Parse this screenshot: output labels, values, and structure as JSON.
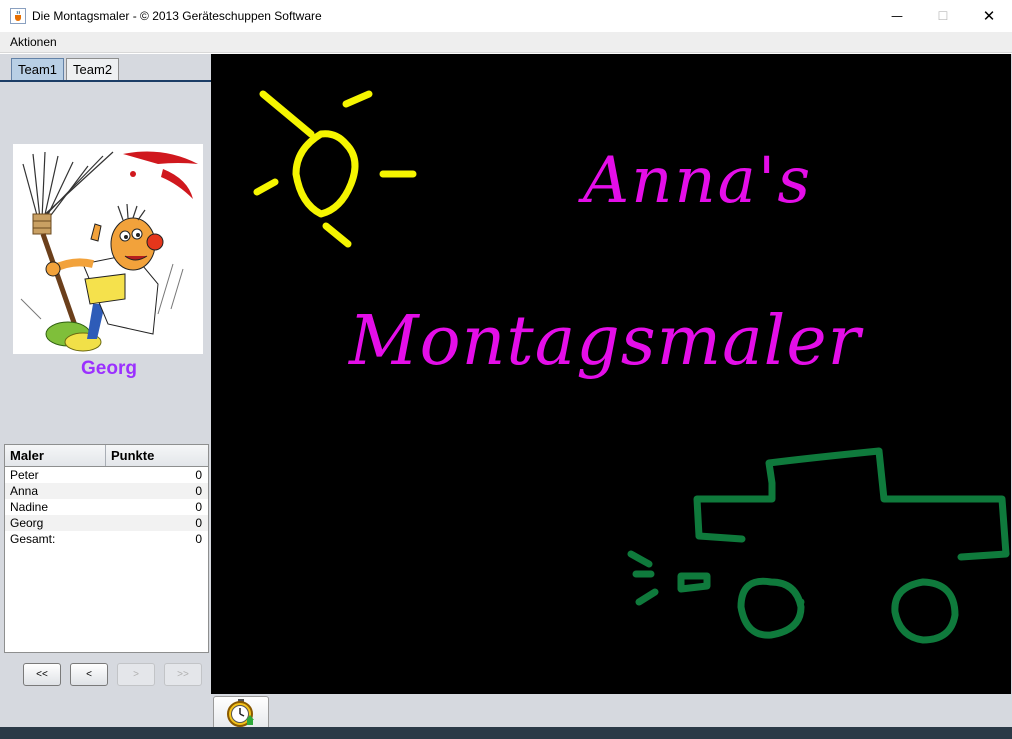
{
  "window": {
    "title": "Die Montagsmaler - © 2013 Geräteschuppen Software",
    "app_icon": "java-cup-icon",
    "minimize_glyph": "—",
    "maximize_glyph": "☐",
    "close_glyph": "✕"
  },
  "menu": {
    "items": [
      "Aktionen"
    ]
  },
  "tabs": [
    {
      "label": "Team1",
      "active": true
    },
    {
      "label": "Team2",
      "active": false
    }
  ],
  "player": {
    "name": "Georg",
    "name_color": "#9b30ff",
    "avatar_icon": "cartoon-painter-icon"
  },
  "score_table": {
    "headers": [
      "Maler",
      "Punkte"
    ],
    "rows": [
      {
        "name": "Peter",
        "points": "0"
      },
      {
        "name": "Anna",
        "points": "0"
      },
      {
        "name": "Nadine",
        "points": "0"
      },
      {
        "name": "Georg",
        "points": "0"
      },
      {
        "name": "Gesamt:",
        "points": "0"
      }
    ]
  },
  "nav_buttons": {
    "first": "<<",
    "prev": "<",
    "next": ">",
    "last": ">>"
  },
  "canvas": {
    "background": "#000000",
    "line1": "Anna's",
    "line2": "Montagsmaler",
    "text_color": "#e40ee8",
    "sun_color": "#f5f500",
    "car_color": "#0f7a3c",
    "drawings": [
      "sun-drawing",
      "car-drawing"
    ]
  },
  "bottom_bar": {
    "timer_icon": "stopwatch-icon"
  }
}
